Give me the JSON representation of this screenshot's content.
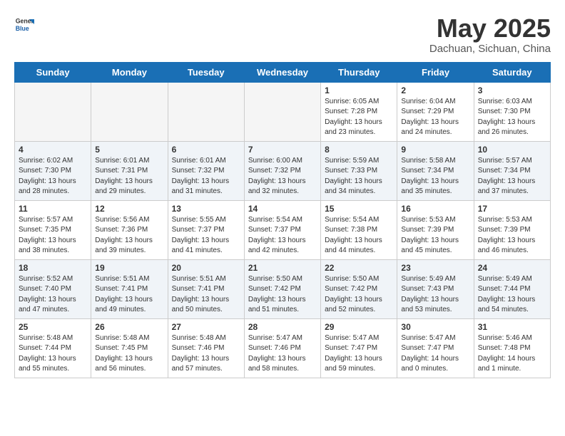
{
  "header": {
    "logo_general": "General",
    "logo_blue": "Blue",
    "month_year": "May 2025",
    "location": "Dachuan, Sichuan, China"
  },
  "weekdays": [
    "Sunday",
    "Monday",
    "Tuesday",
    "Wednesday",
    "Thursday",
    "Friday",
    "Saturday"
  ],
  "weeks": [
    [
      {
        "day": "",
        "info": ""
      },
      {
        "day": "",
        "info": ""
      },
      {
        "day": "",
        "info": ""
      },
      {
        "day": "",
        "info": ""
      },
      {
        "day": "1",
        "info": "Sunrise: 6:05 AM\nSunset: 7:28 PM\nDaylight: 13 hours\nand 23 minutes."
      },
      {
        "day": "2",
        "info": "Sunrise: 6:04 AM\nSunset: 7:29 PM\nDaylight: 13 hours\nand 24 minutes."
      },
      {
        "day": "3",
        "info": "Sunrise: 6:03 AM\nSunset: 7:30 PM\nDaylight: 13 hours\nand 26 minutes."
      }
    ],
    [
      {
        "day": "4",
        "info": "Sunrise: 6:02 AM\nSunset: 7:30 PM\nDaylight: 13 hours\nand 28 minutes."
      },
      {
        "day": "5",
        "info": "Sunrise: 6:01 AM\nSunset: 7:31 PM\nDaylight: 13 hours\nand 29 minutes."
      },
      {
        "day": "6",
        "info": "Sunrise: 6:01 AM\nSunset: 7:32 PM\nDaylight: 13 hours\nand 31 minutes."
      },
      {
        "day": "7",
        "info": "Sunrise: 6:00 AM\nSunset: 7:32 PM\nDaylight: 13 hours\nand 32 minutes."
      },
      {
        "day": "8",
        "info": "Sunrise: 5:59 AM\nSunset: 7:33 PM\nDaylight: 13 hours\nand 34 minutes."
      },
      {
        "day": "9",
        "info": "Sunrise: 5:58 AM\nSunset: 7:34 PM\nDaylight: 13 hours\nand 35 minutes."
      },
      {
        "day": "10",
        "info": "Sunrise: 5:57 AM\nSunset: 7:34 PM\nDaylight: 13 hours\nand 37 minutes."
      }
    ],
    [
      {
        "day": "11",
        "info": "Sunrise: 5:57 AM\nSunset: 7:35 PM\nDaylight: 13 hours\nand 38 minutes."
      },
      {
        "day": "12",
        "info": "Sunrise: 5:56 AM\nSunset: 7:36 PM\nDaylight: 13 hours\nand 39 minutes."
      },
      {
        "day": "13",
        "info": "Sunrise: 5:55 AM\nSunset: 7:37 PM\nDaylight: 13 hours\nand 41 minutes."
      },
      {
        "day": "14",
        "info": "Sunrise: 5:54 AM\nSunset: 7:37 PM\nDaylight: 13 hours\nand 42 minutes."
      },
      {
        "day": "15",
        "info": "Sunrise: 5:54 AM\nSunset: 7:38 PM\nDaylight: 13 hours\nand 44 minutes."
      },
      {
        "day": "16",
        "info": "Sunrise: 5:53 AM\nSunset: 7:39 PM\nDaylight: 13 hours\nand 45 minutes."
      },
      {
        "day": "17",
        "info": "Sunrise: 5:53 AM\nSunset: 7:39 PM\nDaylight: 13 hours\nand 46 minutes."
      }
    ],
    [
      {
        "day": "18",
        "info": "Sunrise: 5:52 AM\nSunset: 7:40 PM\nDaylight: 13 hours\nand 47 minutes."
      },
      {
        "day": "19",
        "info": "Sunrise: 5:51 AM\nSunset: 7:41 PM\nDaylight: 13 hours\nand 49 minutes."
      },
      {
        "day": "20",
        "info": "Sunrise: 5:51 AM\nSunset: 7:41 PM\nDaylight: 13 hours\nand 50 minutes."
      },
      {
        "day": "21",
        "info": "Sunrise: 5:50 AM\nSunset: 7:42 PM\nDaylight: 13 hours\nand 51 minutes."
      },
      {
        "day": "22",
        "info": "Sunrise: 5:50 AM\nSunset: 7:42 PM\nDaylight: 13 hours\nand 52 minutes."
      },
      {
        "day": "23",
        "info": "Sunrise: 5:49 AM\nSunset: 7:43 PM\nDaylight: 13 hours\nand 53 minutes."
      },
      {
        "day": "24",
        "info": "Sunrise: 5:49 AM\nSunset: 7:44 PM\nDaylight: 13 hours\nand 54 minutes."
      }
    ],
    [
      {
        "day": "25",
        "info": "Sunrise: 5:48 AM\nSunset: 7:44 PM\nDaylight: 13 hours\nand 55 minutes."
      },
      {
        "day": "26",
        "info": "Sunrise: 5:48 AM\nSunset: 7:45 PM\nDaylight: 13 hours\nand 56 minutes."
      },
      {
        "day": "27",
        "info": "Sunrise: 5:48 AM\nSunset: 7:46 PM\nDaylight: 13 hours\nand 57 minutes."
      },
      {
        "day": "28",
        "info": "Sunrise: 5:47 AM\nSunset: 7:46 PM\nDaylight: 13 hours\nand 58 minutes."
      },
      {
        "day": "29",
        "info": "Sunrise: 5:47 AM\nSunset: 7:47 PM\nDaylight: 13 hours\nand 59 minutes."
      },
      {
        "day": "30",
        "info": "Sunrise: 5:47 AM\nSunset: 7:47 PM\nDaylight: 14 hours\nand 0 minutes."
      },
      {
        "day": "31",
        "info": "Sunrise: 5:46 AM\nSunset: 7:48 PM\nDaylight: 14 hours\nand 1 minute."
      }
    ]
  ]
}
